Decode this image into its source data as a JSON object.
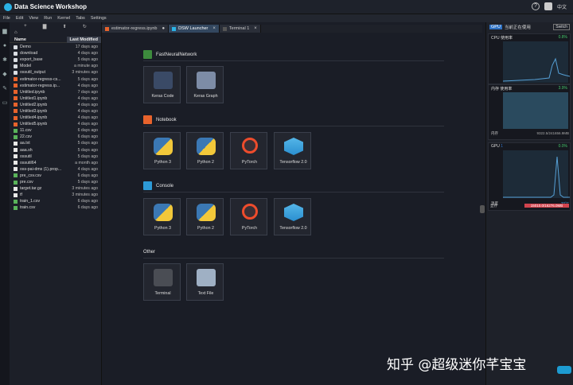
{
  "titlebar": {
    "title": "Data Science Workshop",
    "lang": "中文"
  },
  "menu": [
    "File",
    "Edit",
    "View",
    "Run",
    "Kernel",
    "Tabs",
    "Settings"
  ],
  "filebrowser": {
    "path": "",
    "col_name": "Name",
    "col_modified": "Last Modified",
    "files": [
      {
        "name": "Demo",
        "modified": "17 days ago",
        "kind": "folder"
      },
      {
        "name": "download",
        "modified": "4 days ago",
        "kind": "folder"
      },
      {
        "name": "export_base",
        "modified": "5 days ago",
        "kind": "folder"
      },
      {
        "name": "Model",
        "modified": "a minute ago",
        "kind": "folder"
      },
      {
        "name": "ossutil_output",
        "modified": "3 minutes ago",
        "kind": "folder"
      },
      {
        "name": "estimator-regress-cs...",
        "modified": "5 days ago",
        "kind": "nb"
      },
      {
        "name": "estimator-regress.ip...",
        "modified": "4 days ago",
        "kind": "nb"
      },
      {
        "name": "Untitled.ipynb",
        "modified": "7 days ago",
        "kind": "nb"
      },
      {
        "name": "Untitled1.ipynb",
        "modified": "4 days ago",
        "kind": "nb"
      },
      {
        "name": "Untitled2.ipynb",
        "modified": "4 days ago",
        "kind": "nb"
      },
      {
        "name": "Untitled3.ipynb",
        "modified": "4 days ago",
        "kind": "nb"
      },
      {
        "name": "Untitled4.ipynb",
        "modified": "4 days ago",
        "kind": "nb"
      },
      {
        "name": "Untitled5.ipynb",
        "modified": "4 days ago",
        "kind": "nb"
      },
      {
        "name": "11.csv",
        "modified": "6 days ago",
        "kind": "csv"
      },
      {
        "name": "22.csv",
        "modified": "6 days ago",
        "kind": "csv"
      },
      {
        "name": "aa.txt",
        "modified": "5 days ago",
        "kind": "file"
      },
      {
        "name": "aaa.sh",
        "modified": "5 days ago",
        "kind": "file"
      },
      {
        "name": "ossutil",
        "modified": "5 days ago",
        "kind": "file"
      },
      {
        "name": "ossutil64",
        "modified": "a month ago",
        "kind": "file"
      },
      {
        "name": "oss-pai-dms (1).prop...",
        "modified": "4 days ago",
        "kind": "file"
      },
      {
        "name": "pre_csv.csv",
        "modified": "6 days ago",
        "kind": "csv"
      },
      {
        "name": "pre.csv",
        "modified": "5 days ago",
        "kind": "csv"
      },
      {
        "name": "target.tar.gz",
        "modified": "3 minutes ago",
        "kind": "file"
      },
      {
        "name": "tf",
        "modified": "3 minutes ago",
        "kind": "file"
      },
      {
        "name": "train_1.csv",
        "modified": "6 days ago",
        "kind": "csv"
      },
      {
        "name": "train.csv",
        "modified": "6 days ago",
        "kind": "csv"
      }
    ]
  },
  "tabs": [
    {
      "label": "estimator-regress.ipynb",
      "active": false,
      "dot": "●"
    },
    {
      "label": "DSW Launcher",
      "active": true,
      "dot": "×"
    },
    {
      "label": "Terminal 1",
      "active": false,
      "dot": "×"
    }
  ],
  "launcher": {
    "sections": [
      {
        "title": "FastNeuralNetwork",
        "icon_color": "#3d8b3d",
        "items": [
          "Keras Code",
          "Keras Graph"
        ],
        "styles": [
          "kc",
          "kg"
        ]
      },
      {
        "title": "Notebook",
        "icon_color": "#e8632c",
        "items": [
          "Python 3",
          "Python 2",
          "PyTorch",
          "Tensorflow 2.0"
        ],
        "styles": [
          "py",
          "py",
          "pt",
          "tf"
        ]
      },
      {
        "title": "Console",
        "icon_color": "#2d9ad6",
        "items": [
          "Python 3",
          "Python 2",
          "PyTorch",
          "Tensorflow 2.0"
        ],
        "styles": [
          "py",
          "py",
          "pt",
          "tf"
        ]
      },
      {
        "title": "Other",
        "icon_color": "",
        "items": [
          "Terminal",
          "Text File"
        ],
        "styles": [
          "term",
          "txt"
        ]
      }
    ]
  },
  "monitor": {
    "gpu_badge": "GPU",
    "gpu_status": "当前正在使用",
    "switch": "Switch",
    "cpu": {
      "title": "CPU 使用率",
      "pct": "0.8%"
    },
    "mem": {
      "title": "内存 使用率",
      "pct": "3.9%",
      "label": "内存",
      "value": "9322.5/241656.9MB"
    },
    "gpu": {
      "title": "GPU",
      "index": "1",
      "pct": "0.0%",
      "temp_label": "温度",
      "temp": "32°C",
      "mem_label": "显存",
      "mem_value": "15010.0/16276.0MB"
    }
  },
  "watermark": "知乎 @超级迷你芊宝宝"
}
